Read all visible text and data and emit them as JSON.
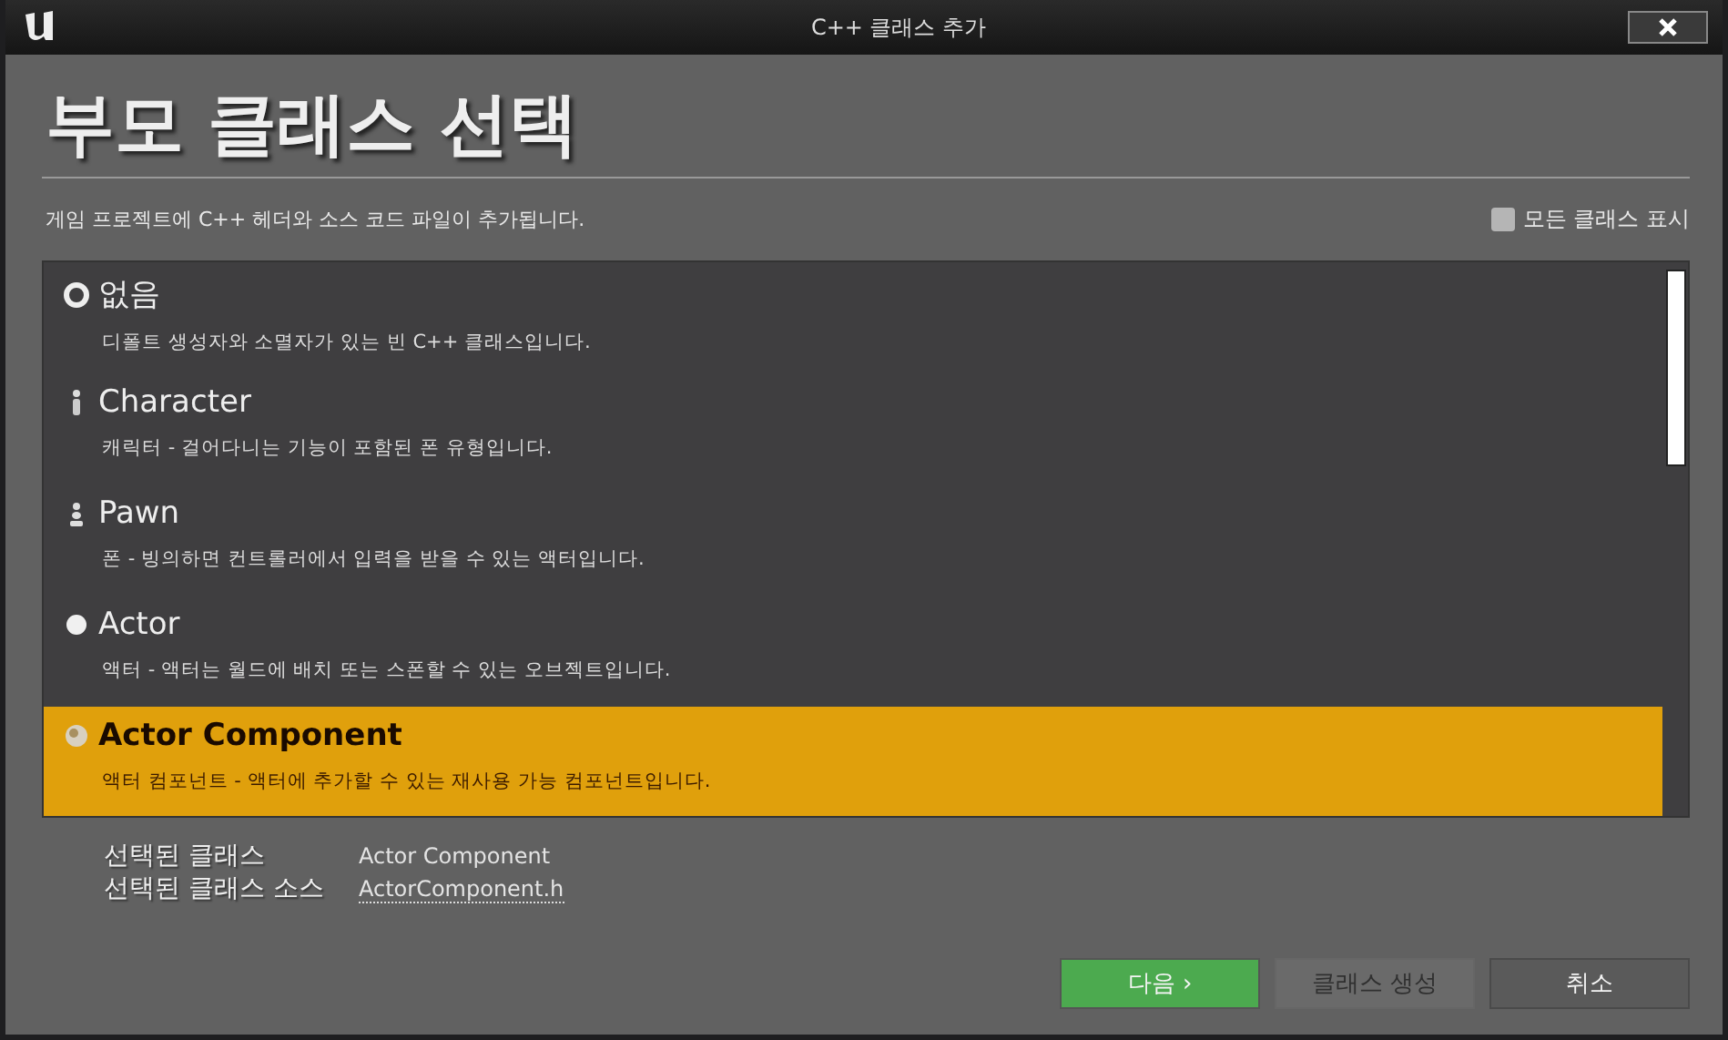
{
  "window": {
    "title": "C++ 클래스 추가"
  },
  "heading": "부모 클래스 선택",
  "description": "게임 프로젝트에 C++ 헤더와 소스 코드 파일이 추가됩니다.",
  "show_all_classes": {
    "label": "모든 클래스 표시",
    "checked": false
  },
  "classes": [
    {
      "kind": "none",
      "name": "없음",
      "description": "디폴트 생성자와 소멸자가 있는 빈 C++ 클래스입니다.",
      "selected": false
    },
    {
      "kind": "character",
      "name": "Character",
      "description": "캐릭터 - 걸어다니는 기능이 포함된 폰 유형입니다.",
      "selected": false
    },
    {
      "kind": "pawn",
      "name": "Pawn",
      "description": "폰 - 빙의하면 컨트롤러에서 입력을 받을 수 있는 액터입니다.",
      "selected": false
    },
    {
      "kind": "actor",
      "name": "Actor",
      "description": "액터 - 액터는 월드에 배치 또는 스폰할 수 있는 오브젝트입니다.",
      "selected": false
    },
    {
      "kind": "component",
      "name": "Actor Component",
      "description": "액터 컴포넌트 - 액터에 추가할 수 있는 재사용 가능 컴포넌트입니다.",
      "selected": true
    }
  ],
  "selected_class": {
    "label": "선택된 클래스",
    "value": "Actor Component"
  },
  "selected_source": {
    "label": "선택된 클래스 소스",
    "value": "ActorComponent.h"
  },
  "buttons": [
    {
      "label": "다음 ›",
      "kind": "primary",
      "disabled": false
    },
    {
      "label": "클래스 생성",
      "kind": "normal",
      "disabled": true
    },
    {
      "label": "취소",
      "kind": "normal",
      "disabled": false
    }
  ]
}
